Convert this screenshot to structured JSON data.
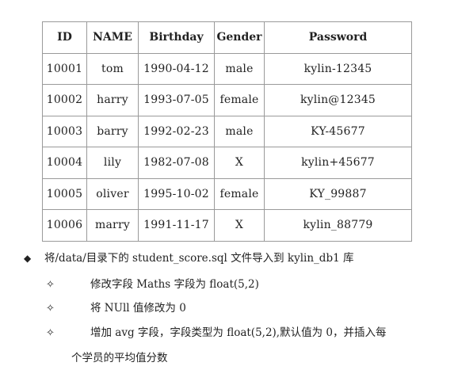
{
  "table": {
    "headers": [
      "ID",
      "NAME",
      "Birthday",
      "Gender",
      "Password"
    ],
    "rows": [
      [
        "10001",
        "tom",
        "1990-04-12",
        "male",
        "kylin-12345"
      ],
      [
        "10002",
        "harry",
        "1993-07-05",
        "female",
        "kylin@12345"
      ],
      [
        "10003",
        "barry",
        "1992-02-23",
        "male",
        "KY-45677"
      ],
      [
        "10004",
        "lily",
        "1982-07-08",
        "X",
        "kylin+45677"
      ],
      [
        "10005",
        "oliver",
        "1995-10-02",
        "female",
        "KY_99887"
      ],
      [
        "10006",
        "marry",
        "1991-11-17",
        "X",
        "kylin_88779"
      ]
    ]
  },
  "notes": {
    "main_bullet": "◆",
    "main_text": "将/data/目录下的 student_score.sql 文件导入到 kylin_db1 库",
    "sub_bullet": "✧",
    "sub_items": [
      "修改字段 Maths 字段为 float(5,2)",
      "将 NUll 值修改为 0",
      "增加 avg 字段，字段类型为 float(5,2),默认值为 0，并插入每"
    ],
    "continuation": "个学员的平均值分数"
  }
}
